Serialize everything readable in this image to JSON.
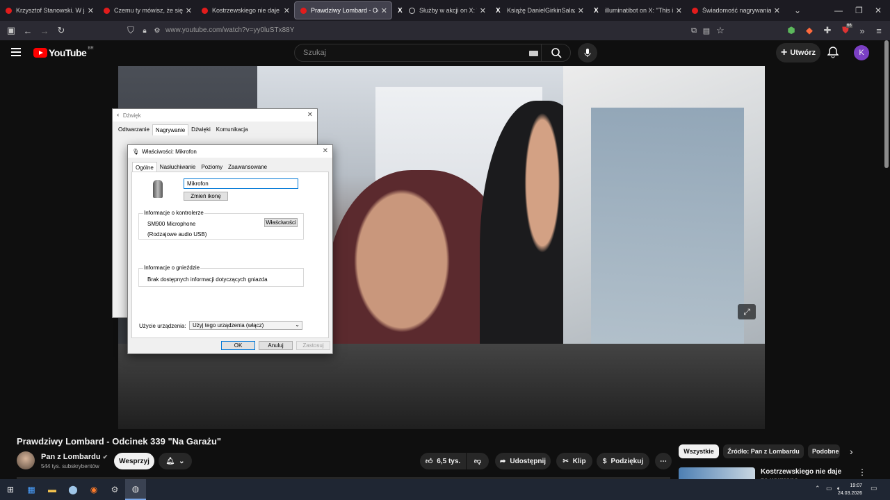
{
  "browser": {
    "tabs": [
      {
        "title": "Krzysztof Stanowski. W jakiej",
        "icon": "youtube-icon",
        "active": false
      },
      {
        "title": "Czemu ty mówisz, że się na c",
        "icon": "youtube-icon",
        "active": false
      },
      {
        "title": "Kostrzewskiego nie daje za w",
        "icon": "youtube-icon",
        "active": false
      },
      {
        "title": "Prawdziwy Lombard - Odcine",
        "icon": "youtube-icon",
        "active": true
      },
      {
        "title": "Służby w akcji on X: \"Nie",
        "icon": "x-icon",
        "active": false
      },
      {
        "title": "Książę DanielGirkinSalazar on",
        "icon": "x-icon",
        "active": false
      },
      {
        "title": "illuminatibot on X: \"This is wi",
        "icon": "x-icon",
        "active": false
      },
      {
        "title": "Świadomość nagrywania (Gie",
        "icon": "youtube-icon",
        "active": false
      }
    ],
    "url": "www.youtube.com/watch?v=yy0luSTx88Y",
    "extension_badge": "66"
  },
  "youtube": {
    "logo_text": "YouTube",
    "region": "BR",
    "search_placeholder": "Szukaj",
    "create_label": "Utwórz",
    "avatar_letter": "K",
    "accent": "#ff0000"
  },
  "dialog_sound": {
    "title": "Dźwięk",
    "tabs": [
      "Odtwarzanie",
      "Nagrywanie",
      "Dźwięki",
      "Komunikacja"
    ],
    "selected_tab": "Nagrywanie"
  },
  "dialog_mic": {
    "title": "Właściwości: Mikrofon",
    "tabs": [
      "Ogólne",
      "Nasłuchiwanie",
      "Poziomy",
      "Zaawansowane"
    ],
    "selected_tab": "Ogólne",
    "name_value": "Mikrofon",
    "change_icon_label": "Zmień ikonę",
    "controller_group": "Informacje o kontrolerze",
    "controller_name": "SM900 Microphone",
    "controller_type": "(Rodzajowe audio USB)",
    "properties_label": "Właściwości",
    "jack_group": "Informacje o gnieździe",
    "jack_info": "Brak dostępnych informacji dotyczących gniazda",
    "usage_label": "Użycie urządzenia:",
    "usage_value": "Użyj tego urządzenia (włącz)",
    "ok_label": "OK",
    "cancel_label": "Anuluj",
    "apply_label": "Zastosuj"
  },
  "video": {
    "title": "Prawdziwy Lombard - Odcinek 339 \"Na Garażu\"",
    "channel": "Pan z Lombardu",
    "subscribers": "544 tys. subskrybentów",
    "join_label": "Wesprzyj",
    "likes": "6,5 tys.",
    "share_label": "Udostępnij",
    "clip_label": "Klip",
    "thanks_label": "Podziękuj"
  },
  "chips": [
    "Wszystkie",
    "Źródło: Pan z Lombardu",
    "Podobne"
  ],
  "next_video": {
    "title": "Kostrzewskiego nie daje za wygrana"
  },
  "taskbar": {
    "time": "19:07",
    "date": "24.03.2026"
  }
}
